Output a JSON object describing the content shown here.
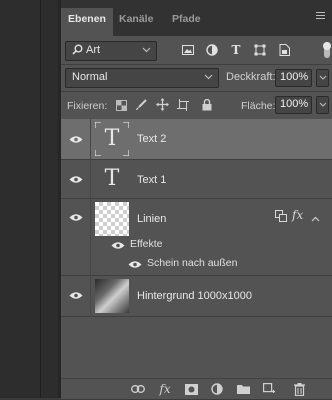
{
  "tabs": [
    {
      "label": "Ebenen",
      "active": true
    },
    {
      "label": "Kanäle",
      "active": false
    },
    {
      "label": "Pfade",
      "active": false
    }
  ],
  "filter": {
    "value": "Art",
    "icons": [
      "image-filter-icon",
      "adjustment-filter-icon",
      "type-filter-icon",
      "shape-filter-icon",
      "smartobject-filter-icon"
    ]
  },
  "blend": {
    "mode": "Normal",
    "opacity_label": "Deckkraft:",
    "opacity_value": "100%"
  },
  "lock": {
    "label": "Fixieren:",
    "fill_label": "Fläche:",
    "fill_value": "100%"
  },
  "layers": [
    {
      "name": "Text 2",
      "kind": "text",
      "selected": true
    },
    {
      "name": "Text 1",
      "kind": "text",
      "selected": false
    },
    {
      "name": "Linien",
      "kind": "pixel",
      "selected": false,
      "effects_label": "Effekte",
      "effect": "Schein nach außen"
    },
    {
      "name": "Hintergrund 1000x1000",
      "kind": "image",
      "selected": false
    }
  ],
  "colors": {
    "panel": "#535353",
    "selected_row": "#6e6e6e",
    "tab_bar": "#323232"
  }
}
